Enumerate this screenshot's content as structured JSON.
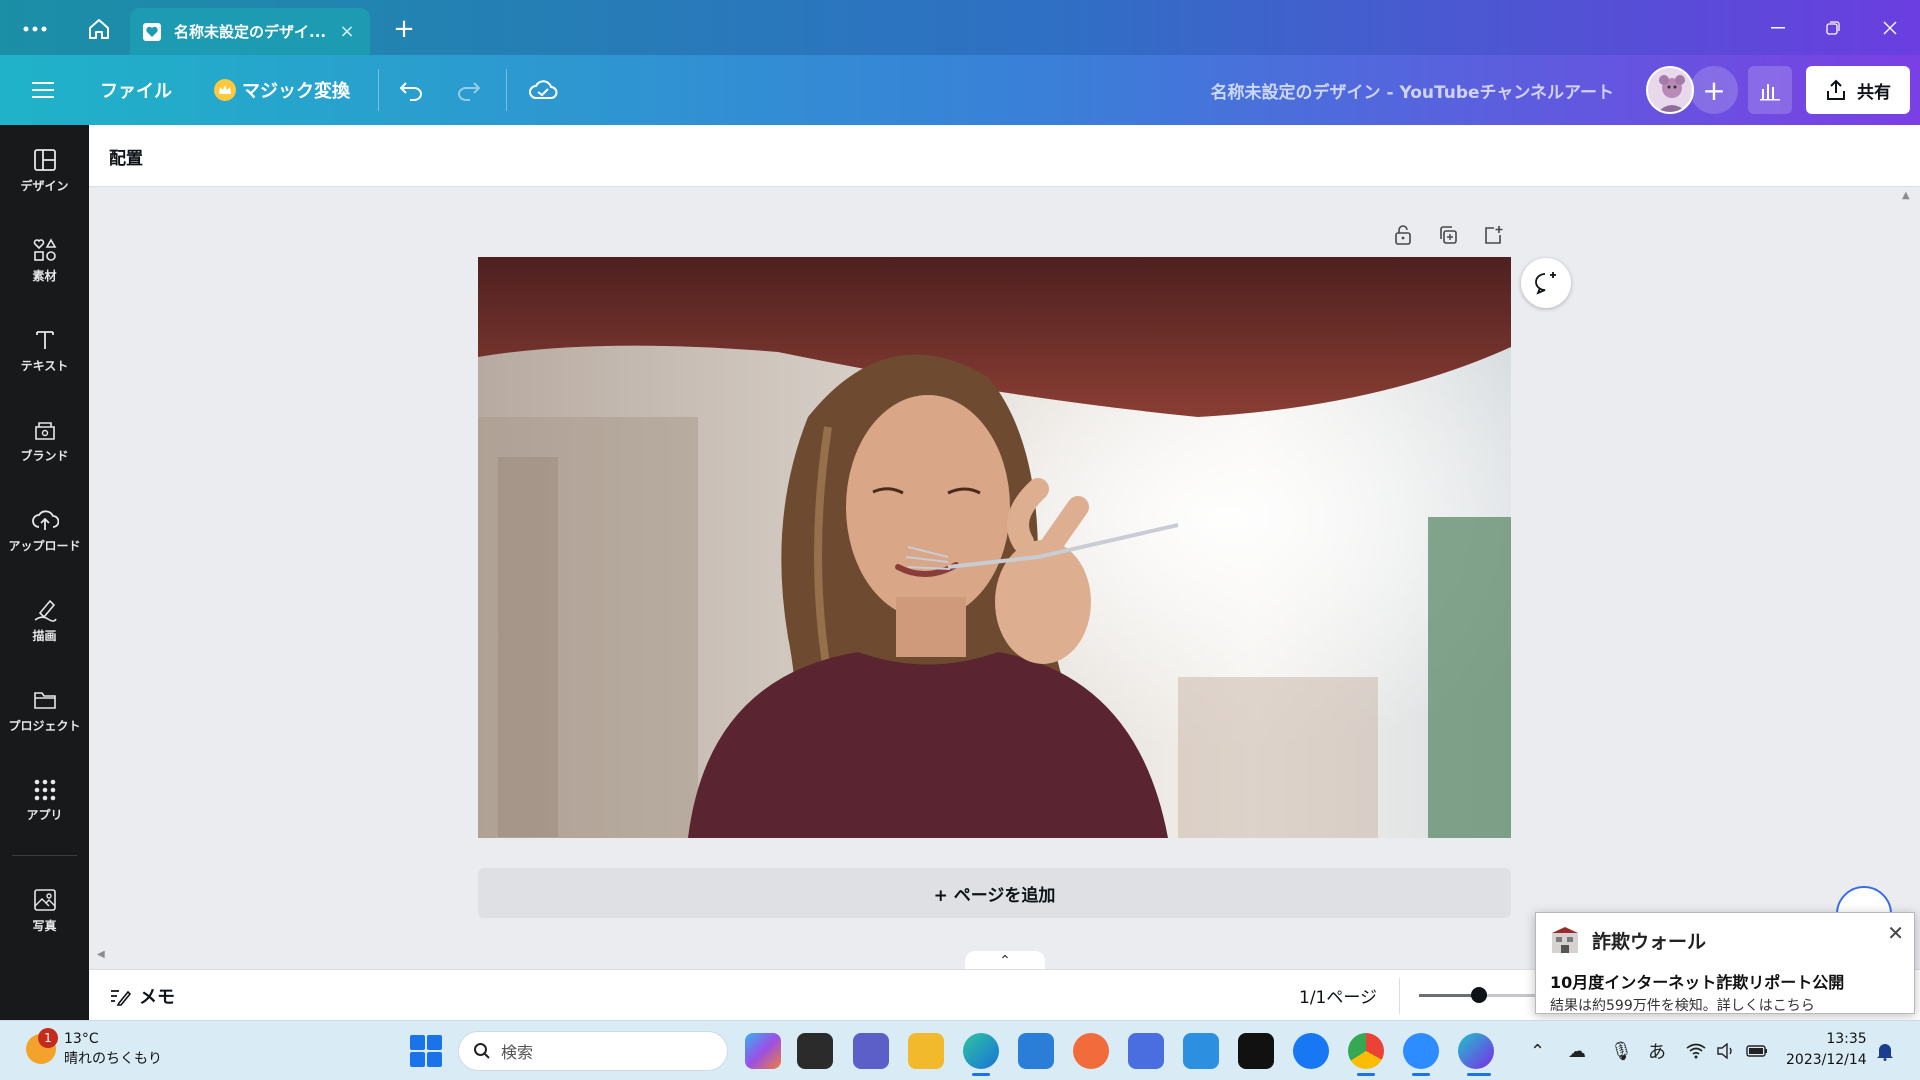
{
  "browser": {
    "tab_title": "名称未設定のデザイ...",
    "close_glyph": "×",
    "new_tab_glyph": "+"
  },
  "topbar": {
    "file_label": "ファイル",
    "magic_label": "マジック変換",
    "doc_title": "名称未設定のデザイン - YouTubeチャンネルアート",
    "add_glyph": "+",
    "share_label": "共有"
  },
  "sidebar": {
    "items": [
      {
        "label": "デザイン",
        "icon": "design-icon"
      },
      {
        "label": "素材",
        "icon": "elements-icon"
      },
      {
        "label": "テキスト",
        "icon": "text-icon"
      },
      {
        "label": "ブランド",
        "icon": "brand-icon"
      },
      {
        "label": "アップロード",
        "icon": "upload-icon"
      },
      {
        "label": "描画",
        "icon": "draw-icon"
      },
      {
        "label": "プロジェクト",
        "icon": "folder-icon"
      },
      {
        "label": "アプリ",
        "icon": "apps-icon"
      },
      {
        "label": "写真",
        "icon": "photo-icon"
      }
    ]
  },
  "context_toolbar": {
    "position_label": "配置"
  },
  "canvas": {
    "add_page_label": "+ ページを追加",
    "collapse_glyph": "⌃"
  },
  "statusbar": {
    "notes_label": "メモ",
    "page_count": "1/1ページ",
    "zoom_fraction": 0.5
  },
  "toast": {
    "app_name": "詐欺ウォール",
    "close_glyph": "✕",
    "title": "10月度インターネット詐欺リポート公開",
    "body": "結果は約599万件を検知。詳しくはこちら"
  },
  "taskbar": {
    "weather_temp": "13°C",
    "weather_desc": "晴れのちくもり",
    "weather_badge": "1",
    "search_placeholder": "検索",
    "ime_label": "あ",
    "time": "13:35",
    "date": "2023/12/14"
  },
  "colors": {
    "canva_gradient_start": "#1fb3c8",
    "canva_gradient_end": "#7b3fe4",
    "sidebar_bg": "#18191b",
    "canvas_bg": "#ebecf0"
  }
}
